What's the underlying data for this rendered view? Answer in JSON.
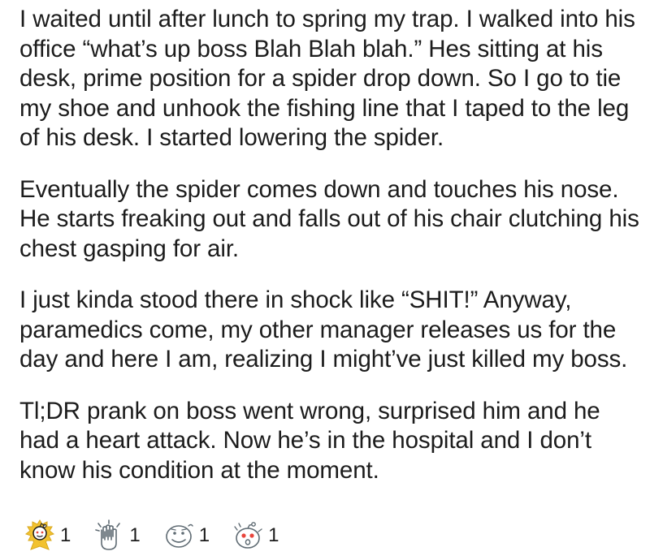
{
  "post": {
    "paragraphs": [
      "I waited until after lunch to spring my trap. I walked into his office “what’s up boss Blah Blah blah.” Hes sitting at his desk, prime position for a spider drop down. So I go to tie my shoe and unhook the fishing line that I taped to the leg of his desk. I started lowering the spider.",
      "Eventually the spider comes down and touches his nose. He starts freaking out and falls out of his chair clutching his chest gasping for air.",
      "I just kinda stood there in shock like “SHIT!” Anyway, paramedics come, my other manager releases us for the day and here I am, realizing I might’ve just killed my boss.",
      "Tl;DR prank on boss went wrong, surprised him and he had a heart attack. Now he’s in the hospital and I don’t know his condition at the moment."
    ]
  },
  "awards": [
    {
      "icon": "gold-award-icon",
      "count": "1"
    },
    {
      "icon": "clapping-hands-award-icon",
      "count": "1"
    },
    {
      "icon": "grimacing-face-award-icon",
      "count": "1"
    },
    {
      "icon": "shocked-face-award-icon",
      "count": "1"
    }
  ],
  "colors": {
    "text": "#1c1c1c",
    "background": "#ffffff",
    "gold": "#f2c230",
    "icon_outline": "#5f6b73"
  }
}
